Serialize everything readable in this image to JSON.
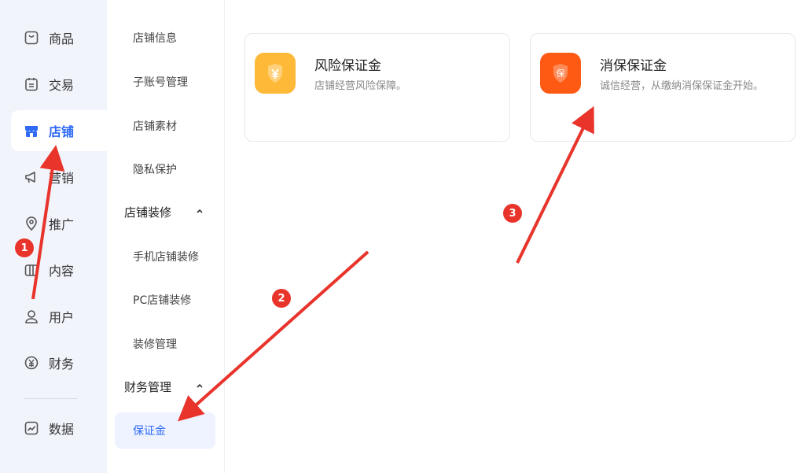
{
  "nav_primary": {
    "items": [
      {
        "label": "商品",
        "icon": "product-icon"
      },
      {
        "label": "交易",
        "icon": "trade-icon"
      },
      {
        "label": "店铺",
        "icon": "shop-icon",
        "active": true
      },
      {
        "label": "营销",
        "icon": "megaphone-icon"
      },
      {
        "label": "推广",
        "icon": "location-icon"
      },
      {
        "label": "内容",
        "icon": "content-icon"
      },
      {
        "label": "用户",
        "icon": "user-icon"
      },
      {
        "label": "财务",
        "icon": "finance-icon"
      },
      {
        "label": "数据",
        "icon": "chart-icon"
      }
    ]
  },
  "nav_secondary": {
    "items": [
      "店铺信息",
      "子账号管理",
      "店铺素材",
      "隐私保护"
    ],
    "group_decoration": "店铺装修",
    "decoration_items": [
      "手机店铺装修",
      "PC店铺装修",
      "装修管理"
    ],
    "group_finance": "财务管理",
    "finance_items": [
      "保证金"
    ]
  },
  "cards": [
    {
      "title": "风险保证金",
      "desc": "店铺经营风险保障。",
      "icon": "shield-yen-icon",
      "color": "#ffb938"
    },
    {
      "title": "消保保证金",
      "desc": "诚信经营，从缴纳消保保证金开始。",
      "icon": "shield-bao-icon",
      "color": "#ff5a14",
      "icon_text": "保"
    }
  ],
  "annotations": [
    "1",
    "2",
    "3"
  ],
  "colors": {
    "accent": "#2f6af5",
    "annotation": "#e8342b"
  }
}
